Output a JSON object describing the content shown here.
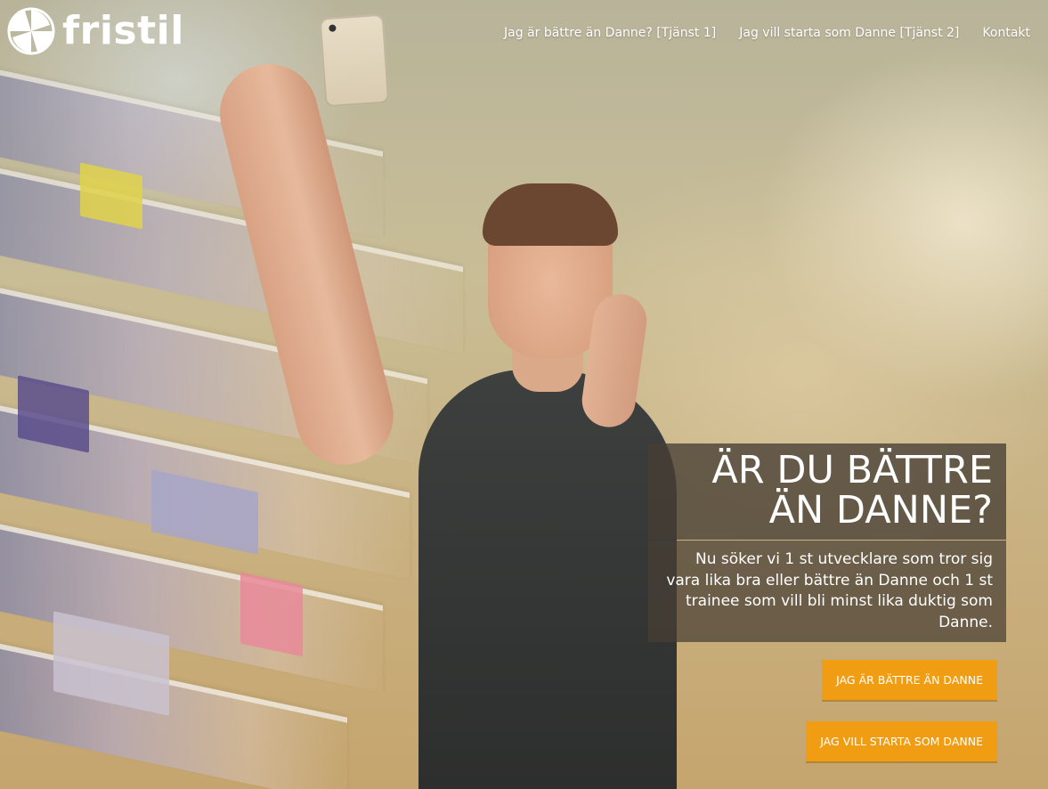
{
  "brand": {
    "name": "fristil",
    "logo_icon": "fristil-pinwheel-logo-icon"
  },
  "nav": {
    "items": [
      {
        "label": "Jag är bättre än Danne? [Tjänst 1]"
      },
      {
        "label": "Jag vill starta som Danne [Tjänst 2]"
      },
      {
        "label": "Kontakt"
      }
    ]
  },
  "hero": {
    "title": "ÄR DU BÄTTRE ÄN DANNE?",
    "text": "Nu söker vi 1 st utvecklare som tror sig vara lika bra eller bättre än Danne och 1 st trainee som vill bli minst lika duktig som Danne.",
    "buttons": [
      {
        "label": "JAG ÄR BÄTTRE ÄN DANNE"
      },
      {
        "label": "JAG VILL STARTA SOM DANNE"
      }
    ]
  },
  "colors": {
    "accent": "#f19d13",
    "card_background": "#463e34",
    "text": "#ffffff"
  }
}
